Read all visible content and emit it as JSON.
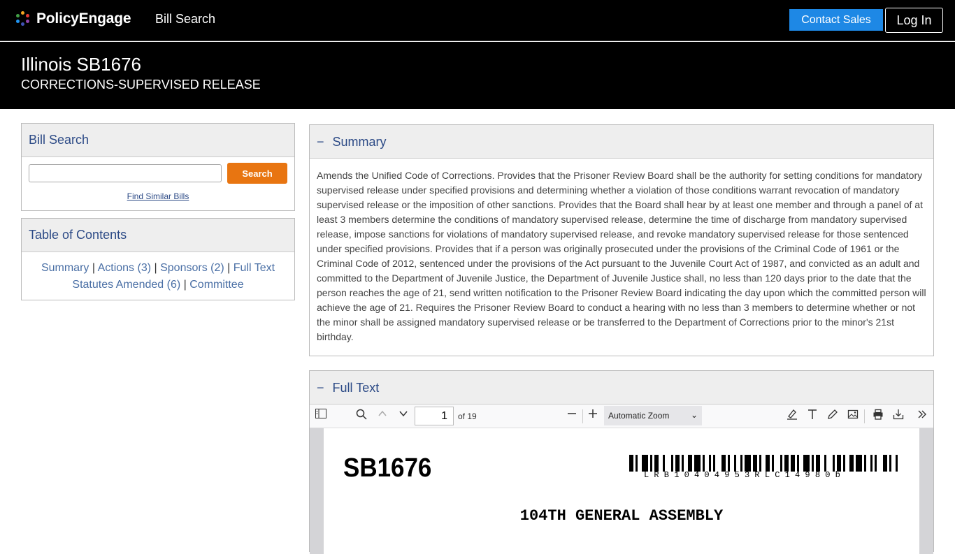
{
  "nav": {
    "brand": "PolicyEngage",
    "link": "Bill Search",
    "contact_sales": "Contact Sales",
    "login": "Log In"
  },
  "header": {
    "title": "Illinois SB1676",
    "subtitle": "CORRECTIONS-SUPERVISED RELEASE"
  },
  "search_panel": {
    "heading": "Bill Search",
    "input_value": "",
    "button": "Search",
    "similar_link": "Find Similar Bills"
  },
  "toc": {
    "heading": "Table of Contents",
    "items": [
      "Summary",
      "Actions (3)",
      "Sponsors (2)",
      "Full Text",
      "Statutes Amended (6)",
      "Committee"
    ],
    "separator": "|"
  },
  "summary": {
    "heading": "Summary",
    "toggle": "−",
    "text": "Amends the Unified Code of Corrections. Provides that the Prisoner Review Board shall be the authority for setting conditions for mandatory supervised release under specified provisions and determining whether a violation of those conditions warrant revocation of mandatory supervised release or the imposition of other sanctions. Provides that the Board shall hear by at least one member and through a panel of at least 3 members determine the conditions of mandatory supervised release, determine the time of discharge from mandatory supervised release, impose sanctions for violations of mandatory supervised release, and revoke mandatory supervised release for those sentenced under specified provisions. Provides that if a person was originally prosecuted under the provisions of the Criminal Code of 1961 or the Criminal Code of 2012, sentenced under the provisions of the Act pursuant to the Juvenile Court Act of 1987, and convicted as an adult and committed to the Department of Juvenile Justice, the Department of Juvenile Justice shall, no less than 120 days prior to the date that the person reaches the age of 21, send written notification to the Prisoner Review Board indicating the day upon which the committed person will achieve the age of 21. Requires the Prisoner Review Board to conduct a hearing with no less than 3 members to determine whether or not the minor shall be assigned mandatory supervised release or be transferred to the Department of Corrections prior to the minor's 21st birthday."
  },
  "fulltext": {
    "heading": "Full Text",
    "toggle": "−",
    "viewer": {
      "page_number": "1",
      "page_count": "of 19",
      "zoom": "Automatic Zoom",
      "icons": [
        "sidebar-toggle-icon",
        "search-icon",
        "chevron-up-icon",
        "chevron-down-icon",
        "zoom-out-icon",
        "zoom-in-icon",
        "highlight-icon",
        "text-icon",
        "draw-icon",
        "image-icon",
        "print-icon",
        "download-icon",
        "more-tools-icon"
      ]
    },
    "document": {
      "bill_number": "SB1676",
      "barcode_text": "LRB10404953RLC14980b",
      "assembly": "104TH GENERAL ASSEMBLY"
    }
  },
  "colors": {
    "brand_blue": "#1e88e5",
    "search_orange": "#e87511",
    "heading_blue": "#2c4a86",
    "link_blue": "#4a6fa5"
  }
}
